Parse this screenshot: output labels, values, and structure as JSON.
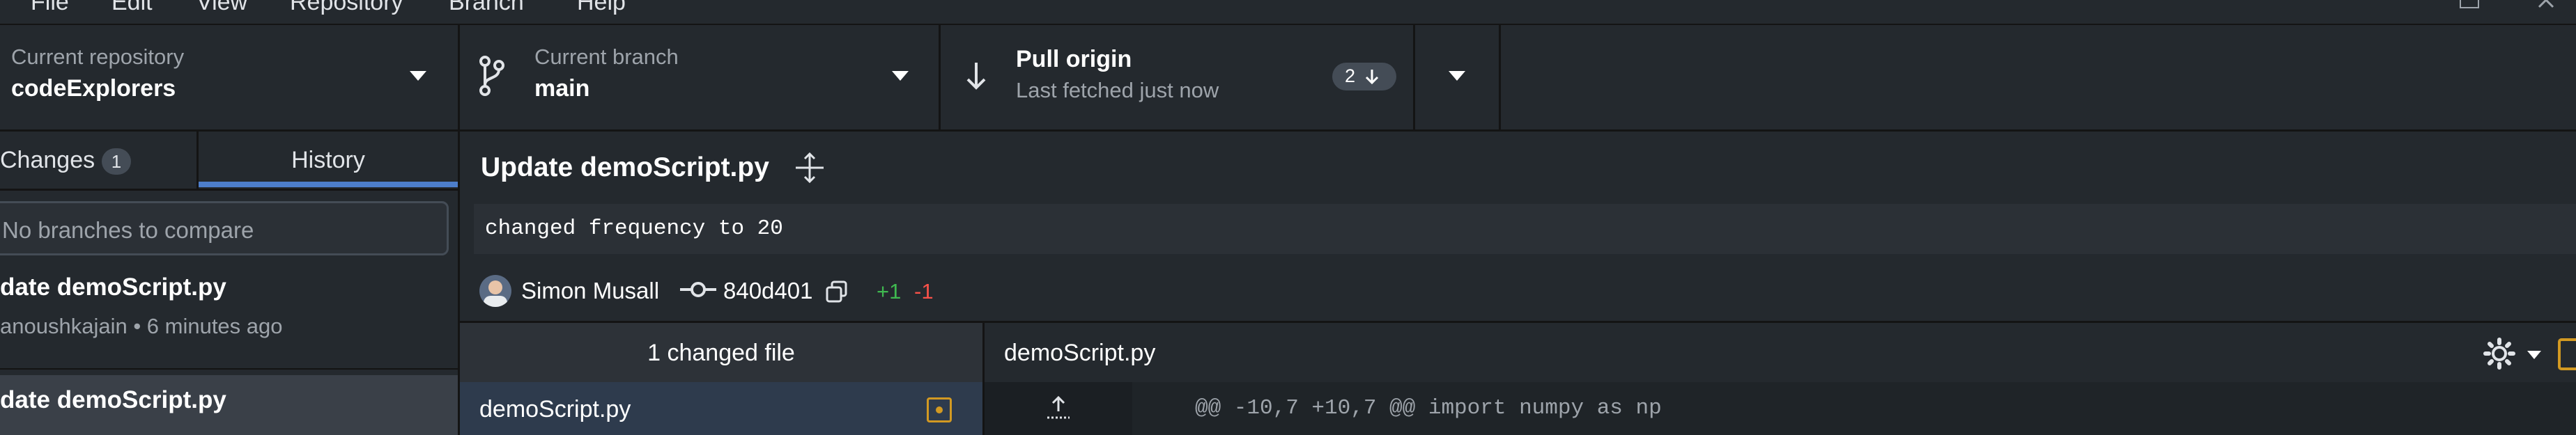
{
  "menu": {
    "items": [
      "File",
      "Edit",
      "View",
      "Repository",
      "Branch",
      "Help"
    ]
  },
  "toolbar": {
    "repo": {
      "label": "Current repository",
      "value": "codeExplorers",
      "icon": "chevron-down-icon"
    },
    "branch": {
      "label": "Current branch",
      "value": "main",
      "icon": "git-branch-icon"
    },
    "pull": {
      "title": "Pull origin",
      "subtitle": "Last fetched just now",
      "badge": "2",
      "icon": "arrow-down-icon"
    }
  },
  "sidebar": {
    "tabs": [
      {
        "label": "Changes",
        "count": "1"
      },
      {
        "label": "History"
      }
    ],
    "compare_placeholder": "No branches to compare",
    "commits": [
      {
        "title": "date demoScript.py",
        "meta": "anoushkajain • 6 minutes ago"
      },
      {
        "title": "date demoScript.py"
      }
    ]
  },
  "commit": {
    "title": "Update demoScript.py",
    "message": "changed frequency to 20",
    "author": "Simon Musall",
    "sha": "840d401",
    "additions": "+1",
    "deletions": "-1"
  },
  "files": {
    "changed_count_label": "1 changed file",
    "items": [
      {
        "name": "demoScript.py"
      }
    ]
  },
  "diff": {
    "file_name": "demoScript.py",
    "hunk_header": "@@ -10,7 +10,7 @@ import numpy as np"
  },
  "colors": {
    "background": "#24292e",
    "accent_blue": "#4d7ecb",
    "added": "#3fb950",
    "deleted": "#f85149",
    "modified_icon": "#d29922"
  }
}
